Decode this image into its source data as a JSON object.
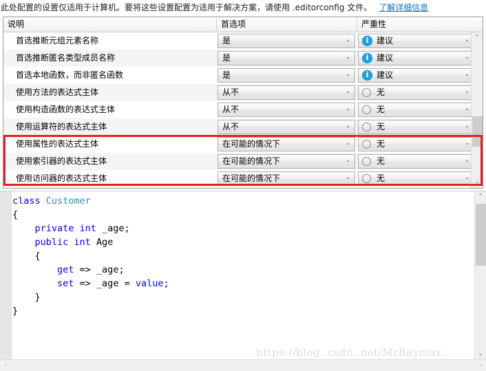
{
  "banner": {
    "text": "此处配置的设置仅适用于计算机。要将这些设置配置为适用于解决方案，请使用 .editorconfig 文件。",
    "link_label": "了解详细信息"
  },
  "grid": {
    "columns": {
      "description": "说明",
      "preference": "首选项",
      "severity": "严重性"
    },
    "rows": [
      {
        "description": "首选推断元组元素名称",
        "preference": "是",
        "severity": "建议",
        "severity_icon": "info-icon",
        "highlighted": false
      },
      {
        "description": "首选推断匿名类型成员名称",
        "preference": "是",
        "severity": "建议",
        "severity_icon": "info-icon",
        "highlighted": false
      },
      {
        "description": "首选本地函数，而非匿名函数",
        "preference": "是",
        "severity": "建议",
        "severity_icon": "info-icon",
        "highlighted": false
      },
      {
        "description": "使用方法的表达式主体",
        "preference": "从不",
        "severity": "无",
        "severity_icon": "circle-icon",
        "highlighted": false
      },
      {
        "description": "使用构造函数的表达式主体",
        "preference": "从不",
        "severity": "无",
        "severity_icon": "circle-icon",
        "highlighted": false
      },
      {
        "description": "使用运算符的表达式主体",
        "preference": "从不",
        "severity": "无",
        "severity_icon": "circle-icon",
        "highlighted": false
      },
      {
        "description": "使用属性的表达式主体",
        "preference": "在可能的情况下",
        "severity": "无",
        "severity_icon": "circle-icon",
        "highlighted": true
      },
      {
        "description": "使用索引器的表达式主体",
        "preference": "在可能的情况下",
        "severity": "无",
        "severity_icon": "circle-icon",
        "highlighted": true
      },
      {
        "description": "使用访问器的表达式主体",
        "preference": "在可能的情况下",
        "severity": "无",
        "severity_icon": "circle-icon",
        "highlighted": true
      }
    ]
  },
  "code_preview": {
    "lines": [
      [
        {
          "t": "class ",
          "c": "kw"
        },
        {
          "t": "Customer",
          "c": "type"
        }
      ],
      [
        {
          "t": "{",
          "c": "punct"
        }
      ],
      [
        {
          "t": "    private int ",
          "c": "kw"
        },
        {
          "t": "_age;",
          "c": "punct"
        }
      ],
      [
        {
          "t": "    public int ",
          "c": "kw"
        },
        {
          "t": "Age",
          "c": "punct"
        }
      ],
      [
        {
          "t": "    {",
          "c": "punct"
        }
      ],
      [
        {
          "t": "        get ",
          "c": "kw"
        },
        {
          "t": "=> _age;",
          "c": "punct"
        }
      ],
      [
        {
          "t": "        set ",
          "c": "kw"
        },
        {
          "t": "=> _age = ",
          "c": "punct"
        },
        {
          "t": "value;",
          "c": "kw"
        }
      ],
      [
        {
          "t": "    }",
          "c": "punct"
        }
      ],
      [
        {
          "t": "}",
          "c": "punct"
        }
      ]
    ]
  },
  "watermark": {
    "text": "https://blog. csdn. net/MrBaymax"
  },
  "colors": {
    "link": "#0e6fc4",
    "highlight_box": "#ec1c24",
    "info_icon": "#1ba1e2",
    "keyword": "#0000ff",
    "type": "#2b91af"
  },
  "icons": {
    "combo_arrow": "⌄",
    "scroll_up": "⌃",
    "scroll_down": "⌄",
    "scroll_left": "‹",
    "scroll_right": "›"
  }
}
